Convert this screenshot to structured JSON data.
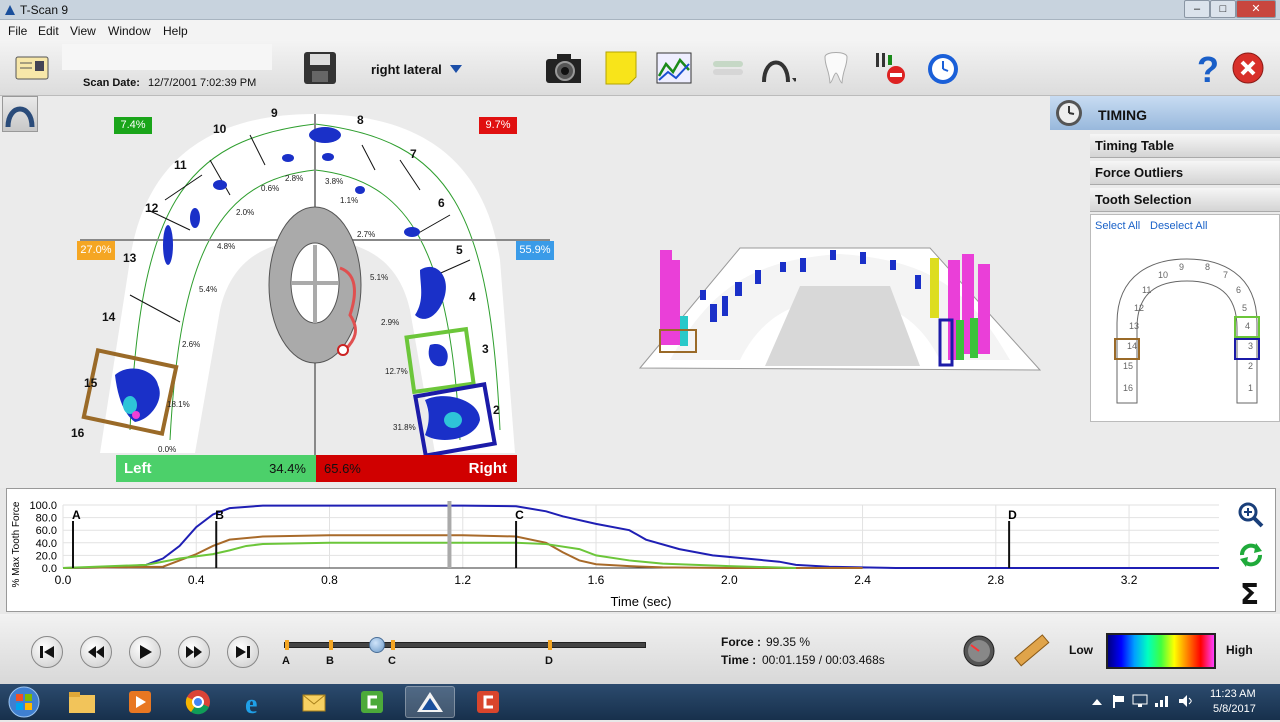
{
  "window": {
    "title": "T-Scan 9"
  },
  "menu": [
    "File",
    "Edit",
    "View",
    "Window",
    "Help"
  ],
  "toolbar": {
    "scan_date_label": "Scan Date:",
    "scan_date": "12/7/2001 7:02:39 PM",
    "view_select": "right lateral"
  },
  "arch": {
    "corner_pcts": {
      "top_left": "7.4%",
      "top_right": "9.7%",
      "mid_left": "27.0%",
      "mid_right": "55.9%"
    },
    "colors": {
      "green": "#1aa51a",
      "red": "#e01010",
      "orange": "#f5a623",
      "blue": "#3a9be8"
    },
    "tooth_numbers": [
      "1",
      "2",
      "3",
      "4",
      "5",
      "6",
      "7",
      "8",
      "9",
      "10",
      "11",
      "12",
      "13",
      "14",
      "15",
      "16"
    ],
    "tooth_pcts": [
      "0.0%",
      "18.1%",
      "2.6%",
      "5.4%",
      "4.8%",
      "2.0%",
      "0.6%",
      "2.8%",
      "3.8%",
      "1.1%",
      "2.7%",
      "5.1%",
      "2.9%",
      "12.7%",
      "31.8%"
    ],
    "left_label": "Left",
    "left_pct": "34.4%",
    "right_pct": "65.6%",
    "right_label": "Right"
  },
  "timing": {
    "title": "TIMING",
    "items": [
      "Timing Table",
      "Force Outliers",
      "Tooth Selection"
    ],
    "select_all": "Select All",
    "deselect_all": "Deselect All",
    "mini_arch_numbers": [
      "1",
      "2",
      "3",
      "4",
      "5",
      "6",
      "7",
      "8",
      "9",
      "10",
      "11",
      "12",
      "13",
      "14",
      "15",
      "16"
    ]
  },
  "chart_data": {
    "type": "line",
    "ylabel": "% Max Tooth Force",
    "xlabel": "Time (sec)",
    "y_ticks": [
      "0.0",
      "20.0",
      "40.0",
      "60.0",
      "80.0",
      "100.0"
    ],
    "x_ticks": [
      "0.0",
      "0.4",
      "0.8",
      "1.2",
      "1.6",
      "2.0",
      "2.4",
      "2.8",
      "3.2"
    ],
    "xlim": [
      0,
      3.47
    ],
    "ylim": [
      0,
      100
    ],
    "markers": [
      {
        "label": "A",
        "x": 0.03
      },
      {
        "label": "B",
        "x": 0.46
      },
      {
        "label": "C",
        "x": 1.36
      },
      {
        "label": "D",
        "x": 2.84
      }
    ],
    "current_time": 1.16,
    "series": [
      {
        "color": "#1f1fb4",
        "x": [
          0,
          0.15,
          0.25,
          0.3,
          0.35,
          0.4,
          0.45,
          0.5,
          0.6,
          0.8,
          1.0,
          1.2,
          1.36,
          1.45,
          1.5,
          1.6,
          1.7,
          1.75,
          1.85,
          1.95,
          2.05,
          2.15,
          2.2,
          2.3,
          2.5,
          3.47
        ],
        "y": [
          0,
          1,
          5,
          15,
          35,
          65,
          85,
          95,
          99,
          99,
          99,
          99,
          98,
          90,
          82,
          70,
          60,
          45,
          30,
          20,
          15,
          10,
          5,
          2,
          0,
          0
        ]
      },
      {
        "color": "#a86a2a",
        "x": [
          0,
          0.3,
          0.4,
          0.45,
          0.5,
          0.6,
          0.8,
          1.0,
          1.2,
          1.36,
          1.45,
          1.5,
          1.55,
          1.6,
          1.7,
          1.8,
          2.0,
          2.4
        ],
        "y": [
          0,
          2,
          22,
          35,
          45,
          50,
          52,
          52,
          52,
          50,
          40,
          25,
          12,
          6,
          3,
          1,
          0,
          0
        ]
      },
      {
        "color": "#6cc63a",
        "x": [
          0,
          0.25,
          0.35,
          0.45,
          0.5,
          0.55,
          0.6,
          0.8,
          1.0,
          1.2,
          1.36,
          1.45,
          1.55,
          1.6,
          1.7,
          1.8,
          1.9,
          2.0,
          2.2
        ],
        "y": [
          0,
          5,
          15,
          22,
          28,
          35,
          38,
          40,
          40,
          40,
          40,
          38,
          30,
          20,
          12,
          7,
          5,
          3,
          0
        ]
      }
    ]
  },
  "player": {
    "force_label": "Force :",
    "force_value": "99.35 %",
    "time_label": "Time :",
    "time_value": "00:01.159 / 00:03.468s",
    "marks": [
      "A",
      "B",
      "C",
      "D"
    ],
    "low": "Low",
    "high": "High"
  },
  "taskbar": {
    "clock_time": "11:23 AM",
    "clock_date": "5/8/2017"
  }
}
